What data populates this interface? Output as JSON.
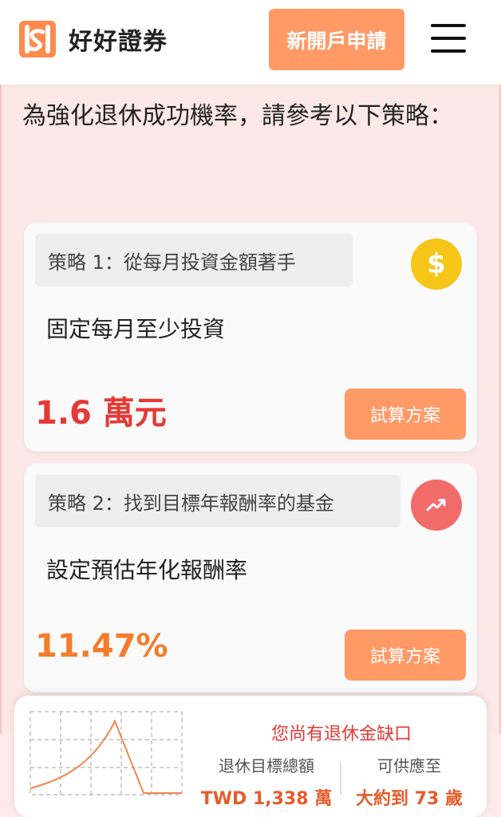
{
  "header": {
    "brand": "好好證券",
    "cta_label": "新開戶申請",
    "logo_icon": "logo-mark-icon",
    "menu_icon": "hamburger-menu-icon"
  },
  "intro": "為強化退休成功機率，請參考以下策略：",
  "strategies": [
    {
      "tag": "策略 1：從每月投資金額著手",
      "icon": "dollar-coin-icon",
      "title": "固定每月至少投資",
      "value": "1.6 萬元",
      "button": "試算方案"
    },
    {
      "tag": "策略 2：找到目標年報酬率的基金",
      "icon": "trending-up-icon",
      "title": "設定預估年化報酬率",
      "value": "11.47%",
      "button": "試算方案"
    }
  ],
  "summary": {
    "gap_title": "您尚有退休金缺口",
    "target_label": "退休目標總額",
    "target_value": "TWD 1,338 萬",
    "lasts_label": "可供應至",
    "lasts_value": "大約到 73 歲"
  },
  "colors": {
    "accent": "#ff9966",
    "danger": "#e53935",
    "panel_bg": "#fde8e8"
  }
}
